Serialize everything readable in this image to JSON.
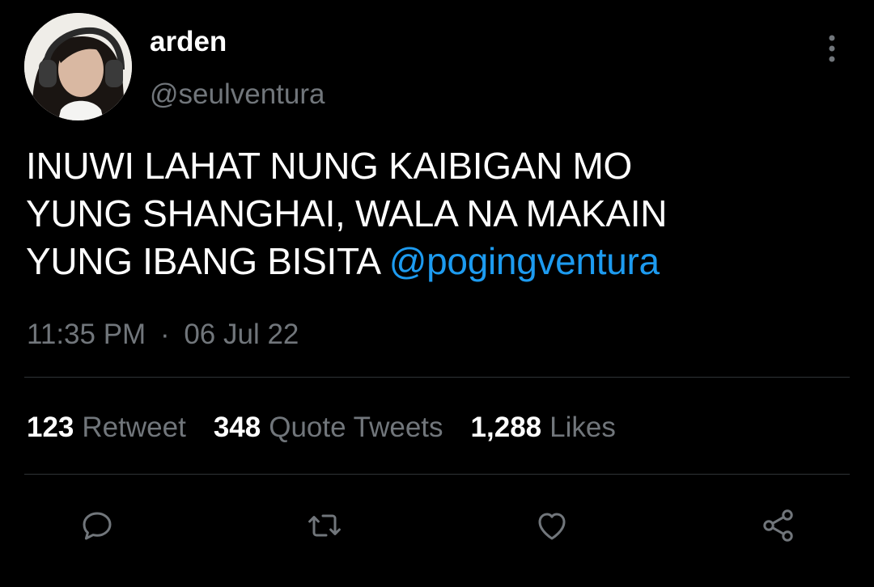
{
  "tweet": {
    "author": {
      "display_name": "arden",
      "handle": "@seulventura"
    },
    "text_lines": [
      "INUWI LAHAT NUNG KAIBIGAN MO",
      "YUNG SHANGHAI, WALA NA MAKAIN",
      "YUNG IBANG BISITA "
    ],
    "mention": "@pogingventura",
    "time": "11:35 PM",
    "separator": "·",
    "date": "06 Jul 22",
    "stats": {
      "retweets": {
        "count": "123",
        "label": "Retweet"
      },
      "quotes": {
        "count": "348",
        "label": "Quote Tweets"
      },
      "likes": {
        "count": "1,288",
        "label": "Likes"
      }
    }
  },
  "icons": {
    "more": "more-vertical-icon",
    "reply": "reply-icon",
    "retweet": "retweet-icon",
    "like": "heart-icon",
    "share": "share-icon"
  },
  "colors": {
    "background": "#000000",
    "text_primary": "#ffffff",
    "text_secondary": "#71767b",
    "accent": "#1d9bf0",
    "divider": "#2f3336"
  }
}
